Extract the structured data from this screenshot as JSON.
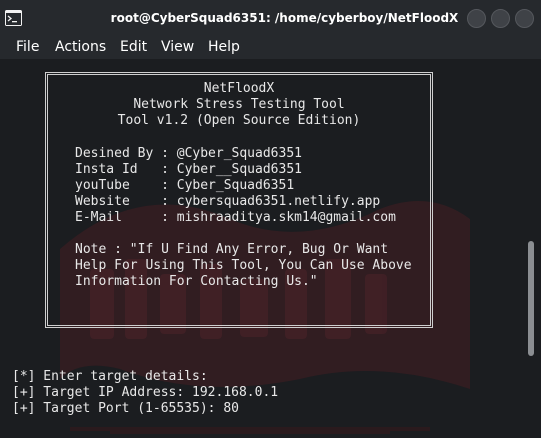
{
  "window": {
    "title": "root@CyberSquad6351: /home/cyberboy/NetFloodX",
    "icon": "terminal-icon"
  },
  "menu": {
    "file": "File",
    "actions": "Actions",
    "edit": "Edit",
    "view": "View",
    "help": "Help"
  },
  "banner": {
    "name": "NetFloodX",
    "subtitle": "Network Stress Testing Tool",
    "version": "Tool v1.2 (Open Source Edition)",
    "designed_by": "Desined By : @Cyber_Squad6351",
    "insta": "Insta Id   : Cyber__Squad6351",
    "youtube": "youTube    : Cyber_Squad6351",
    "website": "Website    : cybersquad6351.netlify.app",
    "email": "E-Mail     : mishraaditya.skm14@gmail.com",
    "note_1": "Note : \"If U Find Any Error, Bug Or Want",
    "note_2": "Help For Using This Tool, You Can Use Above",
    "note_3": "Information For Contacting Us.\""
  },
  "prompts": {
    "enter_details": "[*] Enter target details:",
    "target_ip": "[+] Target IP Address: 192.168.0.1",
    "target_port": "[+] Target Port (1-65535): 80"
  },
  "colors": {
    "background": "#1b1d20",
    "titlebar": "#26292d",
    "text": "#e8e8e8",
    "watermark": "#3a1d22"
  }
}
